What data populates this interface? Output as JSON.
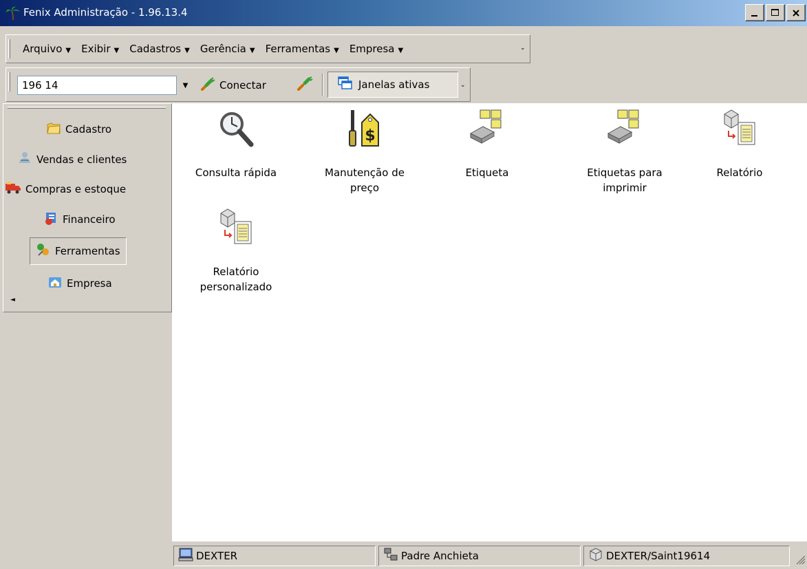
{
  "window": {
    "title": "Fenix Administração - 1.96.13.4"
  },
  "menu": {
    "items": [
      {
        "label": "Arquivo"
      },
      {
        "label": "Exibir"
      },
      {
        "label": "Cadastros"
      },
      {
        "label": "Gerência"
      },
      {
        "label": "Ferramentas"
      },
      {
        "label": "Empresa"
      }
    ]
  },
  "toolbar": {
    "combo_value": "196 14",
    "connect_label": "Conectar",
    "windows_label": "Janelas ativas"
  },
  "sidebar": {
    "items": [
      {
        "label": "Cadastro",
        "icon": "folder-icon"
      },
      {
        "label": "Vendas e clientes",
        "icon": "handshake-icon"
      },
      {
        "label": "Compras e estoque",
        "icon": "truck-icon"
      },
      {
        "label": "Financeiro",
        "icon": "finance-icon"
      },
      {
        "label": "Ferramentas",
        "icon": "tools-icon",
        "active": true
      },
      {
        "label": "Empresa",
        "icon": "company-icon"
      }
    ]
  },
  "content": {
    "tiles": [
      {
        "label": "Consulta rápida",
        "icon": "magnifier-icon"
      },
      {
        "label": "Manutenção de preço",
        "icon": "price-tag-icon"
      },
      {
        "label": "Etiqueta",
        "icon": "label-printer-icon"
      },
      {
        "label": "Etiquetas para imprimir",
        "icon": "label-printer-icon"
      },
      {
        "label": "Relatório",
        "icon": "report-icon"
      },
      {
        "label": "Relatório personalizado",
        "icon": "report-icon"
      }
    ]
  },
  "status": {
    "computer": "DEXTER",
    "branch": "Padre Anchieta",
    "database": "DEXTER/Saint19614"
  }
}
